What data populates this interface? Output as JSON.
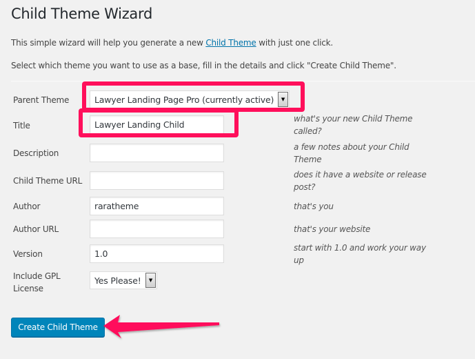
{
  "header": {
    "title": "Child Theme Wizard",
    "intro_prefix": "This simple wizard will help you generate a new ",
    "intro_link": "Child Theme",
    "intro_suffix": " with just one click.",
    "instructions": "Select which theme you want to use as a base, fill in the details and click \"Create Child Theme\"."
  },
  "form": {
    "parent_theme": {
      "label": "Parent Theme",
      "selected": "Lawyer Landing Page Pro (currently active)"
    },
    "title": {
      "label": "Title",
      "value": "Lawyer Landing Child",
      "hint": "what's your new Child Theme called?"
    },
    "description": {
      "label": "Description",
      "value": "",
      "hint": "a few notes about your Child Theme"
    },
    "child_theme_url": {
      "label": "Child Theme URL",
      "value": "",
      "hint": "does it have a website or release post?"
    },
    "author": {
      "label": "Author",
      "value": "raratheme",
      "hint": "that's you"
    },
    "author_url": {
      "label": "Author URL",
      "value": "",
      "hint": "that's your website"
    },
    "version": {
      "label": "Version",
      "value": "1.0",
      "hint": "start with 1.0 and work your way up"
    },
    "gpl_license": {
      "label": "Include GPL License",
      "selected": "Yes Please!"
    }
  },
  "actions": {
    "submit_label": "Create Child Theme"
  },
  "colors": {
    "accent_button": "#0085ba",
    "link": "#0073aa",
    "annotation": "#ff0f5b"
  },
  "icons": {
    "dropdown": "chevron-down-icon",
    "annotation_arrow": "arrow-left-icon"
  }
}
